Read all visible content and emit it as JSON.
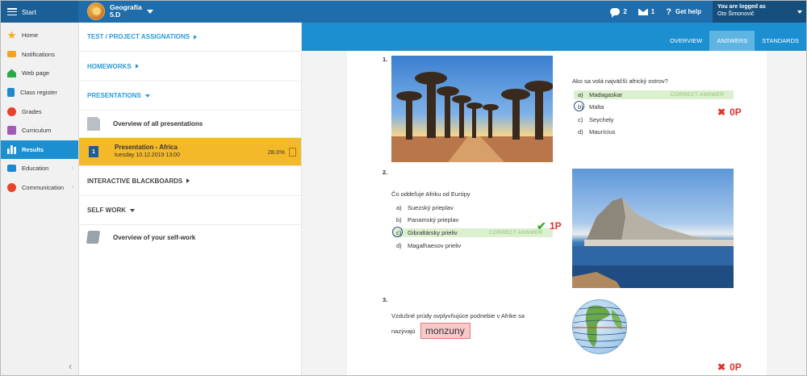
{
  "topbar": {
    "start_label": "Start",
    "course_name": "Geografia",
    "course_class": "5.D",
    "messages_count": "2",
    "mail_count": "1",
    "help_label": "Get help",
    "logged_as_label": "You are logged as",
    "user_name": "Oto Šimonovič"
  },
  "sidebar": {
    "items": [
      {
        "label": "Home",
        "icon": "star-icon",
        "color": "#f2b01e"
      },
      {
        "label": "Notifications",
        "icon": "envelope-icon",
        "color": "#f2a21e"
      },
      {
        "label": "Web page",
        "icon": "house-icon",
        "color": "#2aa84a"
      },
      {
        "label": "Class register",
        "icon": "register-icon",
        "color": "#1e88d0"
      },
      {
        "label": "Grades",
        "icon": "grades-icon",
        "color": "#e8412c"
      },
      {
        "label": "Curriculum",
        "icon": "curriculum-icon",
        "color": "#a05ab8"
      },
      {
        "label": "Results",
        "icon": "chart-icon",
        "color": "#ffffff"
      },
      {
        "label": "Education",
        "icon": "education-icon",
        "color": "#1e88d0"
      },
      {
        "label": "Communication",
        "icon": "chat-icon",
        "color": "#e8412c"
      }
    ],
    "collapse_glyph": "‹"
  },
  "middle": {
    "test_assignations": "TEST / PROJECT ASSIGNATIONS",
    "homeworks": "HOMEWORKS",
    "presentations": "PRESENTATIONS",
    "overview_all": "Overview of all presentations",
    "selected_presentation": {
      "number": "1",
      "title": "Presentation - Africa",
      "date": "tuesday 10.12.2019 13:00",
      "percent": "28.0%"
    },
    "interactive_blackboards": "INTERACTIVE BLACKBOARDS",
    "self_work": "SELF WORK",
    "overview_self_work": "Overview of your self-work"
  },
  "tabs": {
    "overview": "OVERVIEW",
    "answers": "ANSWERS",
    "standards": "STANDARDS"
  },
  "questions": {
    "q1": {
      "number": "1.",
      "text": "Ako sa volá najväčší africký ostrov?",
      "options": [
        {
          "letter": "a)",
          "text": "Madagaskar"
        },
        {
          "letter": "b)",
          "text": "Malta"
        },
        {
          "letter": "c)",
          "text": "Seychely"
        },
        {
          "letter": "d)",
          "text": "Maurícius"
        }
      ],
      "correct_label": "CORRECT ANSWER",
      "score": "0P"
    },
    "q2": {
      "number": "2.",
      "text": "Čo oddeľuje Afriku od Európy",
      "options": [
        {
          "letter": "a)",
          "text": "Suezský prieplav"
        },
        {
          "letter": "b)",
          "text": "Panamský prieplav"
        },
        {
          "letter": "c)",
          "text": "Gibraltársky prieliv"
        },
        {
          "letter": "d)",
          "text": "Magalhaesov prieliv"
        }
      ],
      "correct_label": "CORRECT ANSWER",
      "score": "1P"
    },
    "q3": {
      "number": "3.",
      "text_line1": "Vzdušné prúdy ovplyvňujúce podnebie v Afrike sa",
      "text_line2": "nazývajú",
      "answer": "monzuny",
      "score": "0P"
    }
  }
}
